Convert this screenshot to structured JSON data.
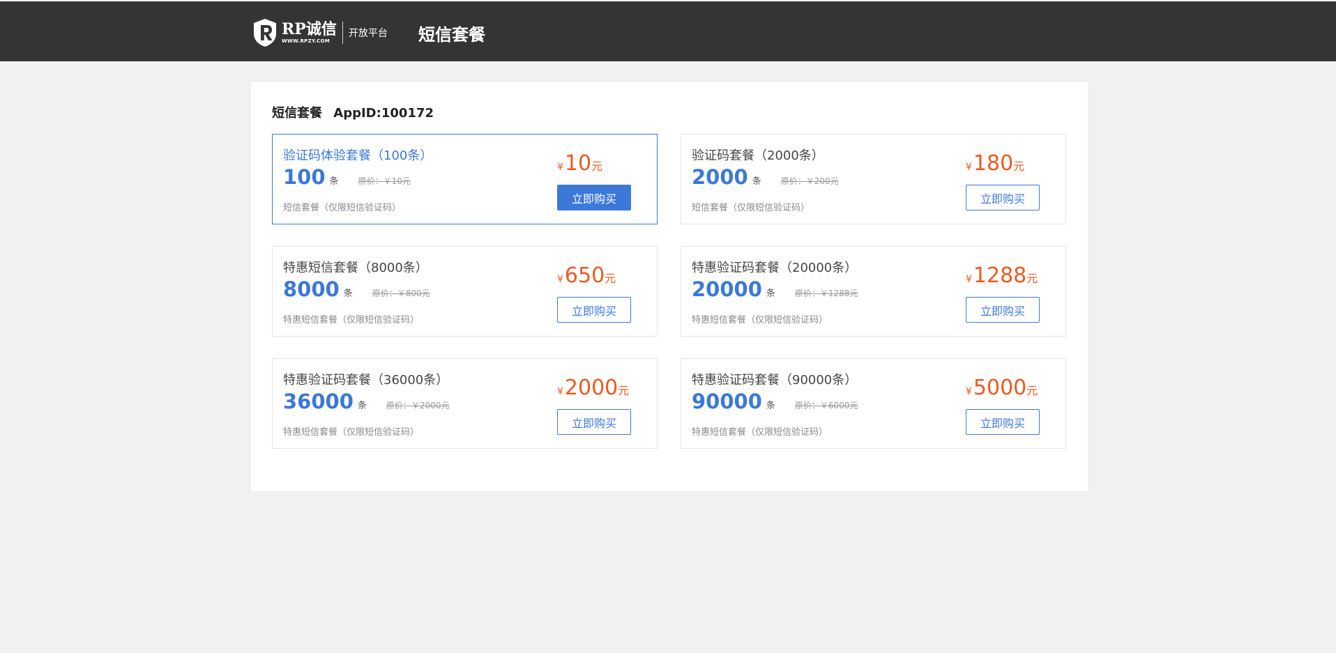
{
  "header": {
    "logo_main": "RP诚信",
    "logo_url": "WWW.RPZY.COM",
    "logo_sub": "开放平台",
    "page_title": "短信套餐"
  },
  "panel": {
    "heading": "短信套餐",
    "appid_label": "AppID:100172"
  },
  "colors": {
    "topbar": "#343434",
    "accent": "#3c78d8",
    "price": "#f0581e"
  },
  "packages": [
    {
      "title": "验证码体验套餐（100条）",
      "count": "100",
      "unit": "条",
      "original_price": "原价：￥10元",
      "description": "短信套餐（仅限短信验证码）",
      "currency": "¥",
      "price": "10",
      "price_unit": "元",
      "button": "立即购买",
      "selected": true
    },
    {
      "title": "验证码套餐（2000条）",
      "count": "2000",
      "unit": "条",
      "original_price": "原价：￥200元",
      "description": "短信套餐（仅限短信验证码）",
      "currency": "¥",
      "price": "180",
      "price_unit": "元",
      "button": "立即购买",
      "selected": false
    },
    {
      "title": "特惠短信套餐（8000条）",
      "count": "8000",
      "unit": "条",
      "original_price": "原价：￥800元",
      "description": "特惠短信套餐（仅限短信验证码）",
      "currency": "¥",
      "price": "650",
      "price_unit": "元",
      "button": "立即购买",
      "selected": false
    },
    {
      "title": "特惠验证码套餐（20000条）",
      "count": "20000",
      "unit": "条",
      "original_price": "原价：￥1288元",
      "description": "特惠短信套餐（仅限短信验证码）",
      "currency": "¥",
      "price": "1288",
      "price_unit": "元",
      "button": "立即购买",
      "selected": false
    },
    {
      "title": "特惠验证码套餐（36000条）",
      "count": "36000",
      "unit": "条",
      "original_price": "原价：￥2000元",
      "description": "特惠短信套餐（仅限短信验证码）",
      "currency": "¥",
      "price": "2000",
      "price_unit": "元",
      "button": "立即购买",
      "selected": false
    },
    {
      "title": "特惠验证码套餐（90000条）",
      "count": "90000",
      "unit": "条",
      "original_price": "原价：￥6000元",
      "description": "特惠短信套餐（仅限短信验证码）",
      "currency": "¥",
      "price": "5000",
      "price_unit": "元",
      "button": "立即购买",
      "selected": false
    }
  ]
}
